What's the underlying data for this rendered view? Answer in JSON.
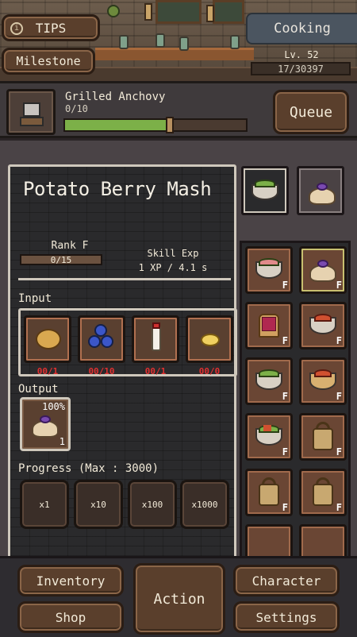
{
  "header": {
    "tips_label": "TIPS",
    "tips_icon": "info-icon",
    "milestone_label": "Milestone",
    "skill_name": "Cooking",
    "level": "Lv. 52",
    "xp": "17/30397"
  },
  "queue": {
    "item_name": "Grilled Anchovy",
    "item_count": "0/10",
    "progress": 0.58,
    "queue_label": "Queue",
    "colors": {
      "progress_fill": "#7cb048"
    }
  },
  "recipe": {
    "title": "Potato Berry Mash",
    "rank_label": "Rank F",
    "rank_progress": "0/15",
    "skill_exp_label": "Skill Exp",
    "skill_exp_value": "1 XP / 4.1 s",
    "input_label": "Input",
    "inputs": [
      {
        "name": "potato",
        "count": "00/1"
      },
      {
        "name": "blueberry",
        "count": "00/10"
      },
      {
        "name": "milk",
        "count": "00/1"
      },
      {
        "name": "butter",
        "count": "00/0"
      }
    ],
    "output_label": "Output",
    "output": {
      "name": "potato-berry-mash",
      "chance": "100%",
      "quantity": "1"
    },
    "progress_label": "Progress (Max : 3000)",
    "multipliers": [
      "x1",
      "x10",
      "x100",
      "x1000"
    ],
    "colors": {
      "missing_count": "#e23030"
    }
  },
  "recipe_list": {
    "tabs": [
      {
        "name": "salad-bowl-tab",
        "active": true
      },
      {
        "name": "mash-tab",
        "active": false
      }
    ],
    "items": [
      {
        "icon": "salad-bowl",
        "rank": "F"
      },
      {
        "icon": "potato-berry-mash",
        "rank": "F"
      },
      {
        "icon": "jam-toast",
        "rank": "F"
      },
      {
        "icon": "tomato-bowl",
        "rank": "F"
      },
      {
        "icon": "salad-bowl",
        "rank": "F"
      },
      {
        "icon": "tomato-bowl",
        "rank": "F"
      },
      {
        "icon": "tomato-salad-bowl",
        "rank": "F"
      },
      {
        "icon": "locked",
        "rank": "F"
      },
      {
        "icon": "locked",
        "rank": "F"
      },
      {
        "icon": "locked",
        "rank": "F"
      }
    ]
  },
  "nav": {
    "inventory": "Inventory",
    "shop": "Shop",
    "action": "Action",
    "character": "Character",
    "settings": "Settings"
  }
}
